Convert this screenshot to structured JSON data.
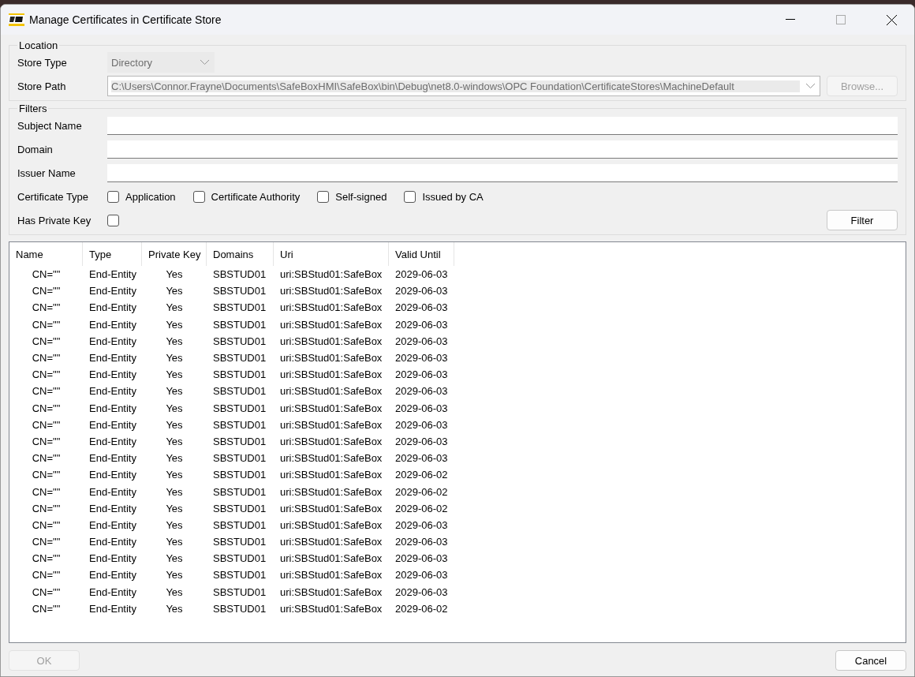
{
  "window": {
    "title": "Manage Certificates in Certificate Store"
  },
  "location": {
    "title": "Location",
    "store_type": {
      "label": "Store Type",
      "value": "Directory"
    },
    "store_path": {
      "label": "Store Path",
      "value": "C:\\Users\\Connor.Frayne\\Documents\\SafeBoxHMI\\SafeBox\\bin\\Debug\\net8.0-windows\\OPC Foundation\\CertificateStores\\MachineDefault"
    },
    "browse_button": {
      "label": "Browse...",
      "disabled": true
    }
  },
  "filters": {
    "title": "Filters",
    "fields": [
      {
        "label": "Subject Name"
      },
      {
        "label": "Domain"
      },
      {
        "label": "Issuer Name"
      }
    ],
    "certificate_type": {
      "label": "Certificate Type",
      "options": [
        {
          "label": "Application",
          "checked": false
        },
        {
          "label": "Certificate Authority",
          "checked": false
        },
        {
          "label": "Self-signed",
          "checked": false
        },
        {
          "label": "Issued by CA",
          "checked": false
        }
      ]
    },
    "private_key": {
      "label": "Has Private Key",
      "checked": false
    },
    "filter_button": "Filter"
  },
  "table": {
    "columns": [
      "Name",
      "Type",
      "Private Key",
      "Domains",
      "Uri",
      "Valid Until"
    ],
    "rows": [
      [
        "CN=\"\"",
        "End-Entity",
        "Yes",
        "SBSTUD01",
        "uri:SBStud01:SafeBox",
        "2029-06-03"
      ],
      [
        "CN=\"\"",
        "End-Entity",
        "Yes",
        "SBSTUD01",
        "uri:SBStud01:SafeBox",
        "2029-06-03"
      ],
      [
        "CN=\"\"",
        "End-Entity",
        "Yes",
        "SBSTUD01",
        "uri:SBStud01:SafeBox",
        "2029-06-03"
      ],
      [
        "CN=\"\"",
        "End-Entity",
        "Yes",
        "SBSTUD01",
        "uri:SBStud01:SafeBox",
        "2029-06-03"
      ],
      [
        "CN=\"\"",
        "End-Entity",
        "Yes",
        "SBSTUD01",
        "uri:SBStud01:SafeBox",
        "2029-06-03"
      ],
      [
        "CN=\"\"",
        "End-Entity",
        "Yes",
        "SBSTUD01",
        "uri:SBStud01:SafeBox",
        "2029-06-03"
      ],
      [
        "CN=\"\"",
        "End-Entity",
        "Yes",
        "SBSTUD01",
        "uri:SBStud01:SafeBox",
        "2029-06-03"
      ],
      [
        "CN=\"\"",
        "End-Entity",
        "Yes",
        "SBSTUD01",
        "uri:SBStud01:SafeBox",
        "2029-06-03"
      ],
      [
        "CN=\"\"",
        "End-Entity",
        "Yes",
        "SBSTUD01",
        "uri:SBStud01:SafeBox",
        "2029-06-03"
      ],
      [
        "CN=\"\"",
        "End-Entity",
        "Yes",
        "SBSTUD01",
        "uri:SBStud01:SafeBox",
        "2029-06-03"
      ],
      [
        "CN=\"\"",
        "End-Entity",
        "Yes",
        "SBSTUD01",
        "uri:SBStud01:SafeBox",
        "2029-06-03"
      ],
      [
        "CN=\"\"",
        "End-Entity",
        "Yes",
        "SBSTUD01",
        "uri:SBStud01:SafeBox",
        "2029-06-03"
      ],
      [
        "CN=\"\"",
        "End-Entity",
        "Yes",
        "SBSTUD01",
        "uri:SBStud01:SafeBox",
        "2029-06-02"
      ],
      [
        "CN=\"\"",
        "End-Entity",
        "Yes",
        "SBSTUD01",
        "uri:SBStud01:SafeBox",
        "2029-06-02"
      ],
      [
        "CN=\"\"",
        "End-Entity",
        "Yes",
        "SBSTUD01",
        "uri:SBStud01:SafeBox",
        "2029-06-02"
      ],
      [
        "CN=\"\"",
        "End-Entity",
        "Yes",
        "SBSTUD01",
        "uri:SBStud01:SafeBox",
        "2029-06-03"
      ],
      [
        "CN=\"\"",
        "End-Entity",
        "Yes",
        "SBSTUD01",
        "uri:SBStud01:SafeBox",
        "2029-06-03"
      ],
      [
        "CN=\"\"",
        "End-Entity",
        "Yes",
        "SBSTUD01",
        "uri:SBStud01:SafeBox",
        "2029-06-03"
      ],
      [
        "CN=\"\"",
        "End-Entity",
        "Yes",
        "SBSTUD01",
        "uri:SBStud01:SafeBox",
        "2029-06-03"
      ],
      [
        "CN=\"\"",
        "End-Entity",
        "Yes",
        "SBSTUD01",
        "uri:SBStud01:SafeBox",
        "2029-06-03"
      ],
      [
        "CN=\"\"",
        "End-Entity",
        "Yes",
        "SBSTUD01",
        "uri:SBStud01:SafeBox",
        "2029-06-02"
      ]
    ]
  },
  "buttons": [
    {
      "label": "OK",
      "disabled": true
    },
    {
      "label": "Cancel",
      "disabled": false
    }
  ]
}
